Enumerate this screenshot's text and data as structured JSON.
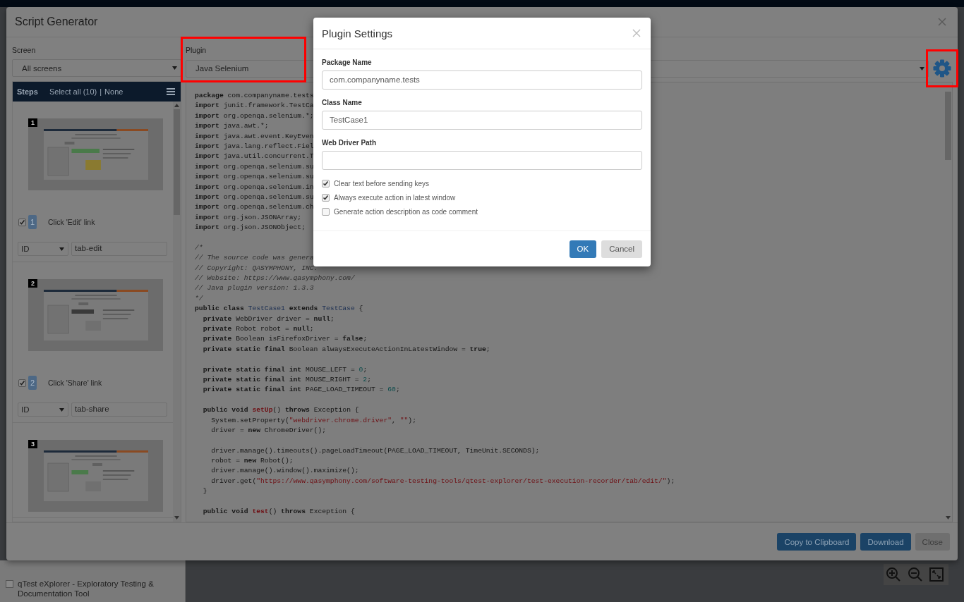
{
  "background": {
    "sidebar_item": {
      "label": "qTest eXplorer - Exploratory Testing & Documentation Tool",
      "checked": false
    }
  },
  "dialog": {
    "title": "Script Generator",
    "screen": {
      "label": "Screen",
      "value": "All screens"
    },
    "plugin": {
      "label": "Plugin",
      "value": "Java Selenium"
    },
    "steps": {
      "title": "Steps",
      "select_all": "Select all (10)",
      "separator": "|",
      "none": "None",
      "items": [
        {
          "number": "1",
          "badge": "1",
          "action": "Click 'Edit' link",
          "checked": true,
          "locator": "ID",
          "value": "tab-edit"
        },
        {
          "number": "2",
          "badge": "2",
          "action": "Click 'Share' link",
          "checked": true,
          "locator": "ID",
          "value": "tab-share"
        },
        {
          "number": "3"
        }
      ]
    },
    "code": [
      {
        "kind": "code",
        "segs": [
          {
            "text": "package",
            "kind": "keyword"
          },
          {
            "text": " com.companyname.tests",
            "kind": "plain"
          }
        ]
      },
      {
        "kind": "code",
        "segs": [
          {
            "text": "import",
            "kind": "keyword"
          },
          {
            "text": " junit.framework.TestCa",
            "kind": "plain"
          }
        ]
      },
      {
        "kind": "code",
        "segs": [
          {
            "text": "import",
            "kind": "keyword"
          },
          {
            "text": " org.openqa.selenium.*;",
            "kind": "plain"
          }
        ]
      },
      {
        "kind": "code",
        "segs": [
          {
            "text": "import",
            "kind": "keyword"
          },
          {
            "text": " java.awt.*;",
            "kind": "plain"
          }
        ]
      },
      {
        "kind": "code",
        "segs": [
          {
            "text": "import",
            "kind": "keyword"
          },
          {
            "text": " java.awt.event.KeyEven",
            "kind": "plain"
          }
        ]
      },
      {
        "kind": "code",
        "segs": [
          {
            "text": "import",
            "kind": "keyword"
          },
          {
            "text": " java.lang.reflect.Fiel",
            "kind": "plain"
          }
        ]
      },
      {
        "kind": "code",
        "segs": [
          {
            "text": "import",
            "kind": "keyword"
          },
          {
            "text": " java.util.concurrent.T",
            "kind": "plain"
          }
        ]
      },
      {
        "kind": "code",
        "segs": [
          {
            "text": "import",
            "kind": "keyword"
          },
          {
            "text": " org.openqa.selenium.su",
            "kind": "plain"
          }
        ]
      },
      {
        "kind": "code",
        "segs": [
          {
            "text": "import",
            "kind": "keyword"
          },
          {
            "text": " org.openqa.selenium.su",
            "kind": "plain"
          }
        ]
      },
      {
        "kind": "code",
        "segs": [
          {
            "text": "import",
            "kind": "keyword"
          },
          {
            "text": " org.openqa.selenium.in",
            "kind": "plain"
          }
        ]
      },
      {
        "kind": "code",
        "segs": [
          {
            "text": "import",
            "kind": "keyword"
          },
          {
            "text": " org.openqa.selenium.su",
            "kind": "plain"
          }
        ]
      },
      {
        "kind": "code",
        "segs": [
          {
            "text": "import",
            "kind": "keyword"
          },
          {
            "text": " org.openqa.selenium.ch",
            "kind": "plain"
          }
        ]
      },
      {
        "kind": "code",
        "segs": [
          {
            "text": "import",
            "kind": "keyword"
          },
          {
            "text": " org.json.JSONArray;",
            "kind": "plain"
          }
        ]
      },
      {
        "kind": "code",
        "segs": [
          {
            "text": "import",
            "kind": "keyword"
          },
          {
            "text": " org.json.JSONObject;",
            "kind": "plain"
          }
        ]
      },
      {
        "kind": "blank"
      },
      {
        "kind": "code",
        "segs": [
          {
            "text": "/*",
            "kind": "comment"
          }
        ]
      },
      {
        "kind": "code",
        "segs": [
          {
            "text": "// The source code was genera",
            "kind": "comment"
          }
        ]
      },
      {
        "kind": "code",
        "segs": [
          {
            "text": "// Copyright: QASYMPHONY, INC.",
            "kind": "comment"
          }
        ]
      },
      {
        "kind": "code",
        "segs": [
          {
            "text": "// Website: https://www.qasymphony.com/",
            "kind": "comment"
          }
        ]
      },
      {
        "kind": "code",
        "segs": [
          {
            "text": "// Java plugin version: 1.3.3",
            "kind": "comment"
          }
        ]
      },
      {
        "kind": "code",
        "segs": [
          {
            "text": "*/",
            "kind": "comment"
          }
        ]
      },
      {
        "kind": "code",
        "segs": [
          {
            "text": "public class ",
            "kind": "keyword"
          },
          {
            "text": "TestCase1",
            "kind": "type"
          },
          {
            "text": " extends ",
            "kind": "keyword"
          },
          {
            "text": "TestCase",
            "kind": "type"
          },
          {
            "text": " {",
            "kind": "plain"
          }
        ]
      },
      {
        "kind": "code",
        "segs": [
          {
            "text": "  private",
            "kind": "keyword"
          },
          {
            "text": " WebDriver driver = ",
            "kind": "plain"
          },
          {
            "text": "null",
            "kind": "keyword"
          },
          {
            "text": ";",
            "kind": "plain"
          }
        ]
      },
      {
        "kind": "code",
        "segs": [
          {
            "text": "  private",
            "kind": "keyword"
          },
          {
            "text": " Robot robot = ",
            "kind": "plain"
          },
          {
            "text": "null",
            "kind": "keyword"
          },
          {
            "text": ";",
            "kind": "plain"
          }
        ]
      },
      {
        "kind": "code",
        "segs": [
          {
            "text": "  private",
            "kind": "keyword"
          },
          {
            "text": " Boolean isFirefoxDriver = ",
            "kind": "plain"
          },
          {
            "text": "false",
            "kind": "keyword"
          },
          {
            "text": ";",
            "kind": "plain"
          }
        ]
      },
      {
        "kind": "code",
        "segs": [
          {
            "text": "  private static final",
            "kind": "keyword"
          },
          {
            "text": " Boolean alwaysExecuteActionInLatestWindow = ",
            "kind": "plain"
          },
          {
            "text": "true",
            "kind": "keyword"
          },
          {
            "text": ";",
            "kind": "plain"
          }
        ]
      },
      {
        "kind": "blank"
      },
      {
        "kind": "code",
        "segs": [
          {
            "text": "  private static final int",
            "kind": "keyword"
          },
          {
            "text": " MOUSE_LEFT = ",
            "kind": "plain"
          },
          {
            "text": "0",
            "kind": "number"
          },
          {
            "text": ";",
            "kind": "plain"
          }
        ]
      },
      {
        "kind": "code",
        "segs": [
          {
            "text": "  private static final int",
            "kind": "keyword"
          },
          {
            "text": " MOUSE_RIGHT = ",
            "kind": "plain"
          },
          {
            "text": "2",
            "kind": "number"
          },
          {
            "text": ";",
            "kind": "plain"
          }
        ]
      },
      {
        "kind": "code",
        "segs": [
          {
            "text": "  private static final int",
            "kind": "keyword"
          },
          {
            "text": " PAGE_LOAD_TIMEOUT = ",
            "kind": "plain"
          },
          {
            "text": "60",
            "kind": "number"
          },
          {
            "text": ";",
            "kind": "plain"
          }
        ]
      },
      {
        "kind": "blank"
      },
      {
        "kind": "code",
        "segs": [
          {
            "text": "  public void ",
            "kind": "keyword"
          },
          {
            "text": "setUp",
            "kind": "method"
          },
          {
            "text": "() ",
            "kind": "plain"
          },
          {
            "text": "throws",
            "kind": "keyword"
          },
          {
            "text": " Exception {",
            "kind": "plain"
          }
        ]
      },
      {
        "kind": "code",
        "segs": [
          {
            "text": "    System.setProperty(",
            "kind": "plain"
          },
          {
            "text": "\"webdriver.chrome.driver\"",
            "kind": "string"
          },
          {
            "text": ", ",
            "kind": "plain"
          },
          {
            "text": "\"\"",
            "kind": "string"
          },
          {
            "text": ");",
            "kind": "plain"
          }
        ]
      },
      {
        "kind": "code",
        "segs": [
          {
            "text": "    driver = ",
            "kind": "plain"
          },
          {
            "text": "new",
            "kind": "keyword"
          },
          {
            "text": " ChromeDriver();",
            "kind": "plain"
          }
        ]
      },
      {
        "kind": "blank"
      },
      {
        "kind": "code",
        "segs": [
          {
            "text": "    driver.manage().timeouts().pageLoadTimeout(PAGE_LOAD_TIMEOUT, TimeUnit.SECONDS);",
            "kind": "plain"
          }
        ]
      },
      {
        "kind": "code",
        "segs": [
          {
            "text": "    robot = ",
            "kind": "plain"
          },
          {
            "text": "new",
            "kind": "keyword"
          },
          {
            "text": " Robot();",
            "kind": "plain"
          }
        ]
      },
      {
        "kind": "code",
        "segs": [
          {
            "text": "    driver.manage().window().maximize();",
            "kind": "plain"
          }
        ]
      },
      {
        "kind": "code",
        "segs": [
          {
            "text": "    driver.get(",
            "kind": "plain"
          },
          {
            "text": "\"https://www.qasymphony.com/software-testing-tools/qtest-explorer/test-execution-recorder/tab/edit/\"",
            "kind": "string"
          },
          {
            "text": ");",
            "kind": "plain"
          }
        ]
      },
      {
        "kind": "code",
        "segs": [
          {
            "text": "  }",
            "kind": "plain"
          }
        ]
      },
      {
        "kind": "blank"
      },
      {
        "kind": "code",
        "segs": [
          {
            "text": "  public void ",
            "kind": "keyword"
          },
          {
            "text": "test",
            "kind": "method"
          },
          {
            "text": "() ",
            "kind": "plain"
          },
          {
            "text": "throws",
            "kind": "keyword"
          },
          {
            "text": " Exception {",
            "kind": "plain"
          }
        ]
      }
    ],
    "buttons": [
      {
        "label": "Copy to Clipboard",
        "kind": "primary"
      },
      {
        "label": "Download",
        "kind": "primary"
      },
      {
        "label": "Close",
        "kind": "default"
      }
    ]
  },
  "plugin_settings": {
    "title": "Plugin Settings",
    "fields": [
      {
        "label": "Package Name",
        "value": "com.companyname.tests"
      },
      {
        "label": "Class Name",
        "value": "TestCase1"
      },
      {
        "label": "Web Driver Path"
      }
    ],
    "options": [
      {
        "label": "Clear text before sending keys",
        "checked": true
      },
      {
        "label": "Always execute action in latest window",
        "checked": true
      },
      {
        "label": "Generate action description as code comment",
        "checked": false
      }
    ],
    "buttons": [
      {
        "label": "OK",
        "kind": "primary"
      },
      {
        "label": "Cancel",
        "kind": "default"
      }
    ]
  }
}
